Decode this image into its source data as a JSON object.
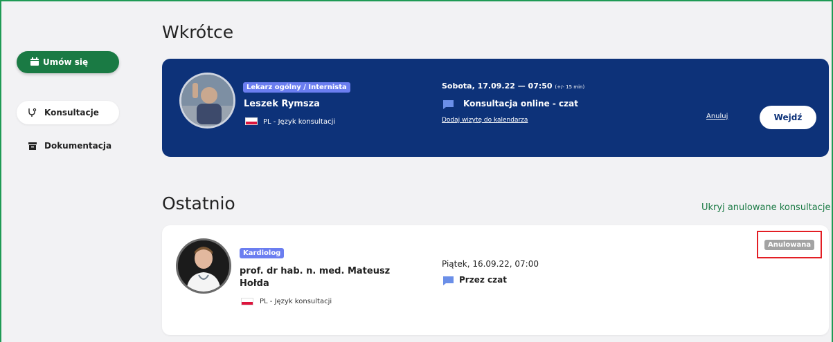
{
  "sidebar": {
    "book_label": "Umów się",
    "items": [
      {
        "label": "Konsultacje"
      },
      {
        "label": "Dokumentacja"
      }
    ]
  },
  "upcoming": {
    "heading": "Wkrótce",
    "specialty": "Lekarz ogólny / Internista",
    "doctor": "Leszek Rymsza",
    "language": "PL - Język konsultacji",
    "datetime": "Sobota, 17.09.22 — 07:50",
    "tolerance": "(+/- 15 min)",
    "type": "Konsultacja online - czat",
    "add_calendar": "Dodaj wizytę do kalendarza",
    "cancel_label": "Anuluj",
    "enter_label": "Wejdź"
  },
  "recent": {
    "heading": "Ostatnio",
    "hide_cancelled": "Ukryj anulowane konsultacje",
    "specialty": "Kardiolog",
    "doctor_line1": "prof. dr hab. n. med. Mateusz",
    "doctor_line2": "Hołda",
    "language": "PL - Język konsultacji",
    "datetime": "Piątek, 16.09.22, 07:00",
    "type": "Przez czat",
    "status": "Anulowana"
  },
  "colors": {
    "brand_green": "#1a7a44",
    "navy": "#0d3279",
    "badge_purple": "#6b7ef0",
    "status_grey": "#a3a3a3",
    "highlight_red": "#e31e24"
  }
}
